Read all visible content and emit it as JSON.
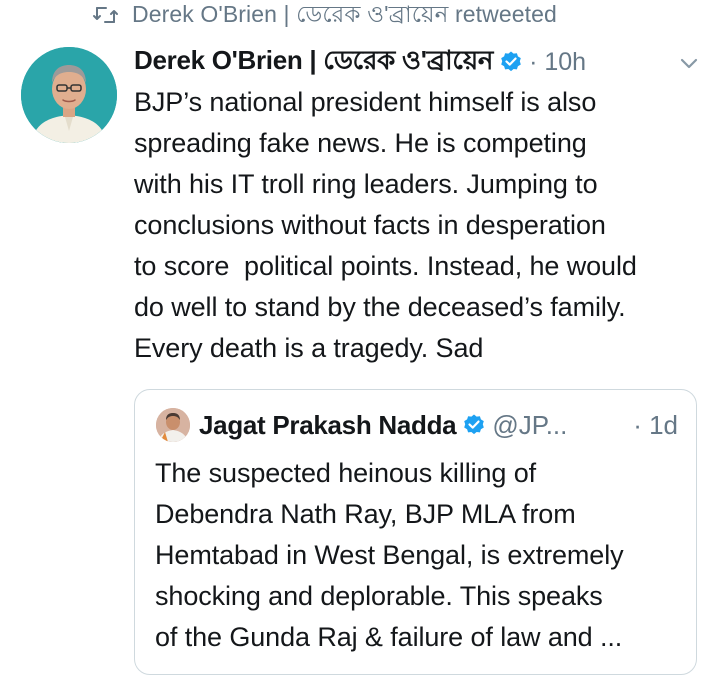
{
  "social_context": {
    "text": "Derek O'Brien | ডেরেক ও'ব্রায়েন retweeted",
    "icon": "retweet-icon"
  },
  "tweet": {
    "author_name": "Derek O'Brien | ডেরেক ও'ব্রায়েন",
    "verified": true,
    "timestamp": "· 10h",
    "text_lines": [
      "BJP’s national president himself is also",
      "spreading fake news. He is competing",
      "with his IT troll ring leaders. Jumping to",
      "conclusions without facts in desperation",
      "to score  political points. Instead, he would",
      "do well to stand by the deceased’s family.",
      "Every death is a tragedy. Sad"
    ]
  },
  "quoted_tweet": {
    "author_name": "Jagat Prakash Nadda",
    "verified": true,
    "handle": "@JP...",
    "timestamp": "· 1d",
    "text_lines": [
      "The suspected heinous killing of",
      "Debendra Nath Ray, BJP MLA from",
      "Hemtabad in West Bengal, is extremely",
      "shocking and deplorable. This speaks",
      "of the Gunda Raj & failure of law and ..."
    ]
  },
  "colors": {
    "text": "#14171a",
    "secondary": "#657786",
    "verified": "#1da1f2",
    "border": "#cfd9de",
    "avatar_bg": "#28a3a7"
  }
}
